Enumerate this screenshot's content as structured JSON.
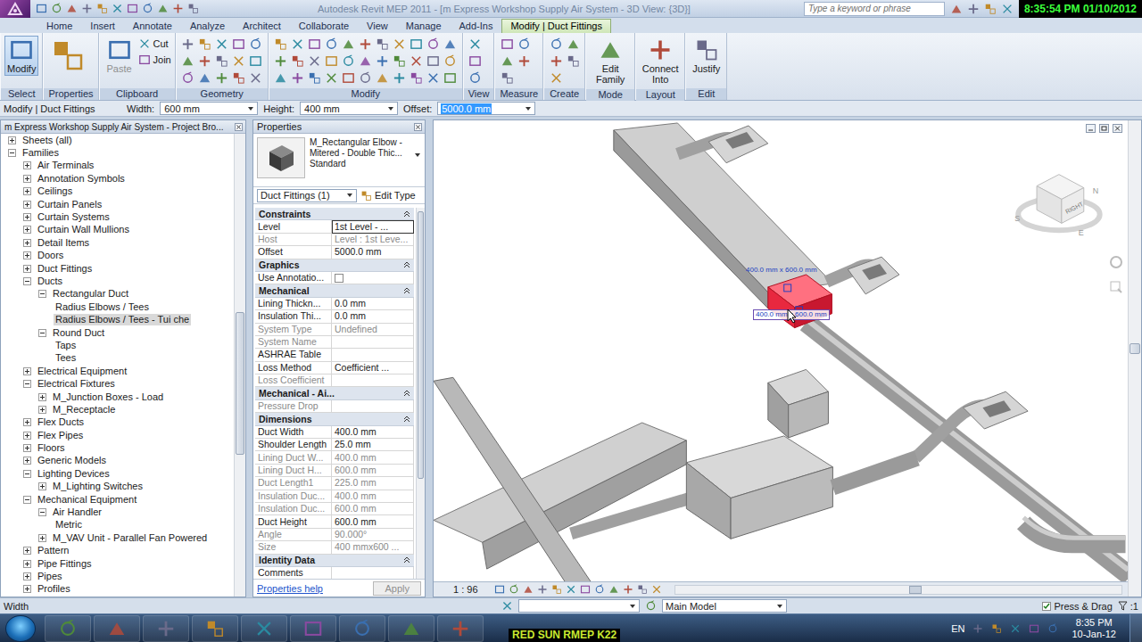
{
  "title_bar": {
    "title": "Autodesk Revit MEP 2011 - [m Express Workshop Supply Air System - 3D View: {3D}]",
    "search": {
      "placeholder": "Type a keyword or phrase"
    },
    "clock": "8:35:54 PM 01/10/2012"
  },
  "ribbon": {
    "tabs": [
      {
        "label": "Home",
        "selected": false
      },
      {
        "label": "Insert",
        "selected": false
      },
      {
        "label": "Annotate",
        "selected": false
      },
      {
        "label": "Analyze",
        "selected": false
      },
      {
        "label": "Architect",
        "selected": false
      },
      {
        "label": "Collaborate",
        "selected": false
      },
      {
        "label": "View",
        "selected": false
      },
      {
        "label": "Manage",
        "selected": false
      },
      {
        "label": "Add-Ins",
        "selected": false
      },
      {
        "label": "Modify | Duct Fittings",
        "selected": true
      }
    ],
    "groups": [
      {
        "label": "Select",
        "kind": "large",
        "buttons": [
          {
            "label": "Modify",
            "selected": true,
            "disabled": false
          }
        ]
      },
      {
        "label": "Properties",
        "kind": "icon",
        "buttons": []
      },
      {
        "label": "Clipboard",
        "kind": "clipboard",
        "buttons": [
          {
            "label": "Paste",
            "selected": false,
            "disabled": true
          },
          {
            "label": "Cut",
            "selected": false,
            "disabled": false
          },
          {
            "label": "Join",
            "selected": false,
            "disabled": false
          }
        ]
      },
      {
        "label": "Geometry",
        "kind": "geometry",
        "buttons": []
      },
      {
        "label": "Modify",
        "kind": "modify",
        "buttons": []
      },
      {
        "label": "View",
        "kind": "tools",
        "buttons": []
      },
      {
        "label": "Measure",
        "kind": "tools",
        "buttons": []
      },
      {
        "label": "Create",
        "kind": "tools",
        "buttons": []
      },
      {
        "label": "Mode",
        "kind": "large",
        "buttons": [
          {
            "label": "Edit Family",
            "selected": false,
            "disabled": false
          }
        ]
      },
      {
        "label": "Layout",
        "kind": "large",
        "buttons": [
          {
            "label": "Connect Into",
            "selected": false,
            "disabled": false
          }
        ]
      },
      {
        "label": "Edit",
        "kind": "large",
        "buttons": [
          {
            "label": "Justify",
            "selected": false,
            "disabled": false
          }
        ]
      }
    ]
  },
  "options_bar": {
    "context": "Modify | Duct Fittings",
    "fields": [
      {
        "label": "Width:",
        "value": "600 mm",
        "selected": false
      },
      {
        "label": "Height:",
        "value": "400 mm",
        "selected": false
      },
      {
        "label": "Offset:",
        "value": "5000.0 mm",
        "selected": true
      }
    ]
  },
  "project_browser": {
    "title": "m Express Workshop Supply Air System - Project Bro...",
    "items": [
      {
        "label": "Sheets (all)",
        "level": 0,
        "kind": "node",
        "expanded": false,
        "selected": false
      },
      {
        "label": "Families",
        "level": 0,
        "kind": "node",
        "expanded": true,
        "selected": false
      },
      {
        "label": "Air Terminals",
        "level": 1,
        "kind": "node",
        "expanded": false,
        "selected": false
      },
      {
        "label": "Annotation Symbols",
        "level": 1,
        "kind": "node",
        "expanded": false,
        "selected": false
      },
      {
        "label": "Ceilings",
        "level": 1,
        "kind": "node",
        "expanded": false,
        "selected": false
      },
      {
        "label": "Curtain Panels",
        "level": 1,
        "kind": "node",
        "expanded": false,
        "selected": false
      },
      {
        "label": "Curtain Systems",
        "level": 1,
        "kind": "node",
        "expanded": false,
        "selected": false
      },
      {
        "label": "Curtain Wall Mullions",
        "level": 1,
        "kind": "node",
        "expanded": false,
        "selected": false
      },
      {
        "label": "Detail Items",
        "level": 1,
        "kind": "node",
        "expanded": false,
        "selected": false
      },
      {
        "label": "Doors",
        "level": 1,
        "kind": "node",
        "expanded": false,
        "selected": false
      },
      {
        "label": "Duct Fittings",
        "level": 1,
        "kind": "node",
        "expanded": false,
        "selected": false
      },
      {
        "label": "Ducts",
        "level": 1,
        "kind": "node",
        "expanded": true,
        "selected": false
      },
      {
        "label": "Rectangular Duct",
        "level": 2,
        "kind": "node",
        "expanded": true,
        "selected": false
      },
      {
        "label": "Radius Elbows / Tees",
        "level": 3,
        "kind": "leaf",
        "selected": false
      },
      {
        "label": "Radius Elbows / Tees - Tui che",
        "level": 3,
        "kind": "leaf",
        "selected": true
      },
      {
        "label": "Round Duct",
        "level": 2,
        "kind": "node",
        "expanded": true,
        "selected": false
      },
      {
        "label": "Taps",
        "level": 3,
        "kind": "leaf",
        "selected": false
      },
      {
        "label": "Tees",
        "level": 3,
        "kind": "leaf",
        "selected": false
      },
      {
        "label": "Electrical Equipment",
        "level": 1,
        "kind": "node",
        "expanded": false,
        "selected": false
      },
      {
        "label": "Electrical Fixtures",
        "level": 1,
        "kind": "node",
        "expanded": true,
        "selected": false
      },
      {
        "label": "M_Junction Boxes - Load",
        "level": 2,
        "kind": "node",
        "expanded": false,
        "selected": false
      },
      {
        "label": "M_Receptacle",
        "level": 2,
        "kind": "node",
        "expanded": false,
        "selected": false
      },
      {
        "label": "Flex Ducts",
        "level": 1,
        "kind": "node",
        "expanded": false,
        "selected": false
      },
      {
        "label": "Flex Pipes",
        "level": 1,
        "kind": "node",
        "expanded": false,
        "selected": false
      },
      {
        "label": "Floors",
        "level": 1,
        "kind": "node",
        "expanded": false,
        "selected": false
      },
      {
        "label": "Generic Models",
        "level": 1,
        "kind": "node",
        "expanded": false,
        "selected": false
      },
      {
        "label": "Lighting Devices",
        "level": 1,
        "kind": "node",
        "expanded": true,
        "selected": false
      },
      {
        "label": "M_Lighting Switches",
        "level": 2,
        "kind": "node",
        "expanded": false,
        "selected": false
      },
      {
        "label": "Mechanical Equipment",
        "level": 1,
        "kind": "node",
        "expanded": true,
        "selected": false
      },
      {
        "label": "Air Handler",
        "level": 2,
        "kind": "node",
        "expanded": true,
        "selected": false
      },
      {
        "label": "Metric",
        "level": 3,
        "kind": "leaf",
        "selected": false
      },
      {
        "label": "M_VAV Unit - Parallel Fan Powered",
        "level": 2,
        "kind": "node",
        "expanded": false,
        "selected": false
      },
      {
        "label": "Pattern",
        "level": 1,
        "kind": "node",
        "expanded": false,
        "selected": false
      },
      {
        "label": "Pipe Fittings",
        "level": 1,
        "kind": "node",
        "expanded": false,
        "selected": false
      },
      {
        "label": "Pipes",
        "level": 1,
        "kind": "node",
        "expanded": false,
        "selected": false
      },
      {
        "label": "Profiles",
        "level": 1,
        "kind": "node",
        "expanded": false,
        "selected": false
      }
    ]
  },
  "properties": {
    "title": "Properties",
    "type": {
      "name": "M_Rectangular Elbow - Mitered - Double Thic...",
      "subtype": "Standard"
    },
    "instance_filter": "Duct Fittings (1)",
    "edit_type": "Edit Type",
    "rows": [
      {
        "kind": "group",
        "label": "Constraints"
      },
      {
        "kind": "property",
        "name": "Level",
        "value": "1st Level - ...",
        "disabled": false,
        "editing": true
      },
      {
        "kind": "property",
        "name": "Host",
        "value": "Level : 1st Leve...",
        "disabled": true,
        "editing": false
      },
      {
        "kind": "property",
        "name": "Offset",
        "value": "5000.0 mm",
        "disabled": false,
        "editing": false
      },
      {
        "kind": "group",
        "label": "Graphics"
      },
      {
        "kind": "checkbox",
        "name": "Use Annotatio...",
        "checked": false,
        "disabled": false
      },
      {
        "kind": "group",
        "label": "Mechanical"
      },
      {
        "kind": "property",
        "name": "Lining Thickn...",
        "value": "0.0 mm",
        "disabled": false,
        "editing": false
      },
      {
        "kind": "property",
        "name": "Insulation Thi...",
        "value": "0.0 mm",
        "disabled": false,
        "editing": false
      },
      {
        "kind": "property",
        "name": "System Type",
        "value": "Undefined",
        "disabled": true,
        "editing": false
      },
      {
        "kind": "property",
        "name": "System Name",
        "disabled": true,
        "editing": false
      },
      {
        "kind": "property",
        "name": "ASHRAE Table",
        "disabled": false,
        "editing": false
      },
      {
        "kind": "property",
        "name": "Loss Method",
        "value": "Coefficient ...",
        "disabled": false,
        "editing": false
      },
      {
        "kind": "property",
        "name": "Loss Coefficient",
        "disabled": true,
        "editing": false
      },
      {
        "kind": "group",
        "label": "Mechanical - Ai..."
      },
      {
        "kind": "property",
        "name": "Pressure Drop",
        "disabled": true,
        "editing": false
      },
      {
        "kind": "group",
        "label": "Dimensions"
      },
      {
        "kind": "property",
        "name": "Duct Width",
        "value": "400.0 mm",
        "disabled": false,
        "editing": false
      },
      {
        "kind": "property",
        "name": "Shoulder Length",
        "value": "25.0 mm",
        "disabled": false,
        "editing": false
      },
      {
        "kind": "property",
        "name": "Lining Duct W...",
        "value": "400.0 mm",
        "disabled": true,
        "editing": false
      },
      {
        "kind": "property",
        "name": "Lining Duct H...",
        "value": "600.0 mm",
        "disabled": true,
        "editing": false
      },
      {
        "kind": "property",
        "name": "Duct Length1",
        "value": "225.0 mm",
        "disabled": true,
        "editing": false
      },
      {
        "kind": "property",
        "name": "Insulation Duc...",
        "value": "400.0 mm",
        "disabled": true,
        "editing": false
      },
      {
        "kind": "property",
        "name": "Insulation Duc...",
        "value": "600.0 mm",
        "disabled": true,
        "editing": false
      },
      {
        "kind": "property",
        "name": "Duct Height",
        "value": "600.0 mm",
        "disabled": false,
        "editing": false
      },
      {
        "kind": "property",
        "name": "Angle",
        "value": "90.000°",
        "disabled": true,
        "editing": false
      },
      {
        "kind": "property",
        "name": "Size",
        "value": "400 mmx600 ...",
        "disabled": true,
        "editing": false
      },
      {
        "kind": "group",
        "label": "Identity Data"
      },
      {
        "kind": "property",
        "name": "Comments",
        "disabled": false,
        "editing": false
      }
    ],
    "help": "Properties help",
    "apply": {
      "label": "Apply",
      "disabled": true
    }
  },
  "view": {
    "scale": "1 : 96",
    "view_cube": {
      "face": "RIGHT",
      "compass": [
        "S",
        "N",
        "E"
      ]
    },
    "dimension_labels": [
      {
        "text": "400.0 mm x 600.0 mm",
        "boxed": false
      },
      {
        "text": "400.0 mm x 600.0 mm",
        "boxed": true
      }
    ]
  },
  "status_bar": {
    "message": "Width",
    "workset": "Main Model",
    "press_drag": {
      "label": "Press & Drag",
      "checked": true
    },
    "selection_count": ":1"
  },
  "taskbar": {
    "language": "EN",
    "time": "8:35 PM",
    "date": "10-Jan-12",
    "watermark": "RED SUN RMEP K22"
  }
}
